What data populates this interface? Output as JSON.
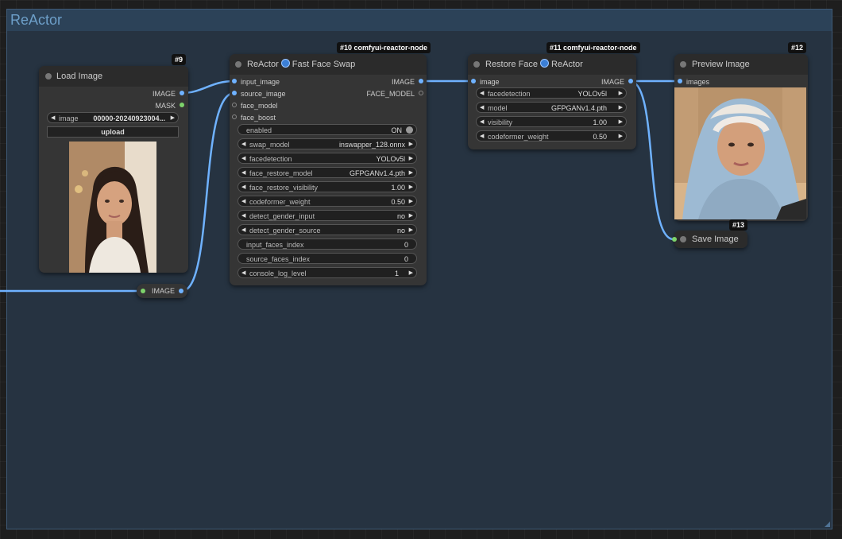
{
  "group": {
    "title": "ReActor"
  },
  "load_image": {
    "badge": "#9",
    "title": "Load Image",
    "outputs": [
      "IMAGE",
      "MASK"
    ],
    "image_widget": {
      "label": "image",
      "value": "00000-20240923004..."
    },
    "upload_label": "upload"
  },
  "reroute": {
    "label": "IMAGE"
  },
  "fast_swap": {
    "badge": "#10 comfyui-reactor-node",
    "title_left": "ReActor",
    "title_right": "Fast Face Swap",
    "inputs": [
      "input_image",
      "source_image",
      "face_model",
      "face_boost"
    ],
    "outputs": [
      "IMAGE",
      "FACE_MODEL"
    ],
    "widgets": [
      {
        "label": "enabled",
        "value": "ON",
        "kind": "toggle"
      },
      {
        "label": "swap_model",
        "value": "inswapper_128.onnx",
        "kind": "combo"
      },
      {
        "label": "facedetection",
        "value": "YOLOv5l",
        "kind": "combo"
      },
      {
        "label": "face_restore_model",
        "value": "GFPGANv1.4.pth",
        "kind": "combo"
      },
      {
        "label": "face_restore_visibility",
        "value": "1.00",
        "kind": "combo"
      },
      {
        "label": "codeformer_weight",
        "value": "0.50",
        "kind": "combo"
      },
      {
        "label": "detect_gender_input",
        "value": "no",
        "kind": "combo"
      },
      {
        "label": "detect_gender_source",
        "value": "no",
        "kind": "combo"
      },
      {
        "label": "input_faces_index",
        "value": "0",
        "kind": "text"
      },
      {
        "label": "source_faces_index",
        "value": "0",
        "kind": "text"
      },
      {
        "label": "console_log_level",
        "value": "1",
        "kind": "combo"
      }
    ]
  },
  "restore_face": {
    "badge": "#11 comfyui-reactor-node",
    "title_left": "Restore Face",
    "title_right": "ReActor",
    "inputs": [
      "image"
    ],
    "outputs": [
      "IMAGE"
    ],
    "widgets": [
      {
        "label": "facedetection",
        "value": "YOLOv5l"
      },
      {
        "label": "model",
        "value": "GFPGANv1.4.pth"
      },
      {
        "label": "visibility",
        "value": "1.00"
      },
      {
        "label": "codeformer_weight",
        "value": "0.50"
      }
    ]
  },
  "preview": {
    "badge": "#12",
    "title": "Preview Image",
    "inputs": [
      "images"
    ]
  },
  "save": {
    "badge": "#13",
    "title": "Save Image"
  },
  "colors": {
    "link": "#6fb2ff",
    "group_border": "#3f5b78",
    "group_title": "#6d9fc9"
  }
}
